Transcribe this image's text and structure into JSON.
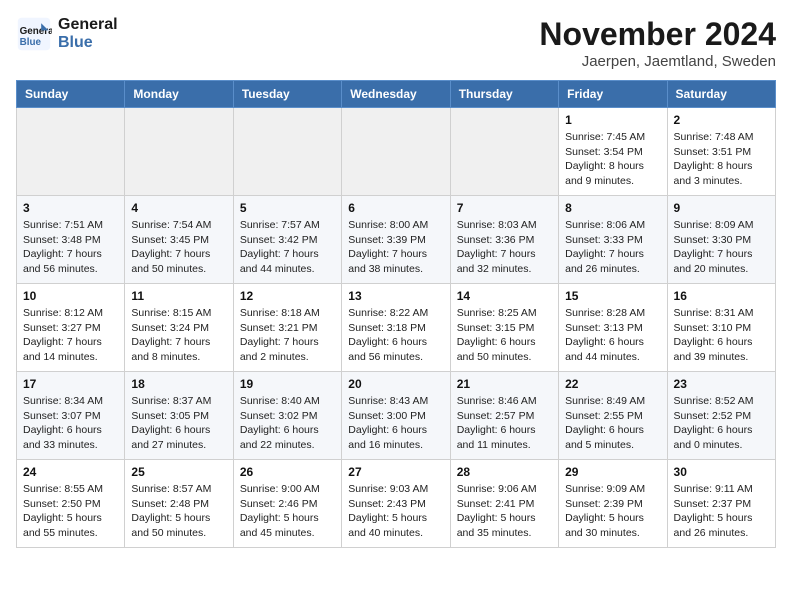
{
  "header": {
    "logo_line1": "General",
    "logo_line2": "Blue",
    "month_title": "November 2024",
    "location": "Jaerpen, Jaemtland, Sweden"
  },
  "weekdays": [
    "Sunday",
    "Monday",
    "Tuesday",
    "Wednesday",
    "Thursday",
    "Friday",
    "Saturday"
  ],
  "weeks": [
    [
      {
        "day": "",
        "info": ""
      },
      {
        "day": "",
        "info": ""
      },
      {
        "day": "",
        "info": ""
      },
      {
        "day": "",
        "info": ""
      },
      {
        "day": "",
        "info": ""
      },
      {
        "day": "1",
        "info": "Sunrise: 7:45 AM\nSunset: 3:54 PM\nDaylight: 8 hours\nand 9 minutes."
      },
      {
        "day": "2",
        "info": "Sunrise: 7:48 AM\nSunset: 3:51 PM\nDaylight: 8 hours\nand 3 minutes."
      }
    ],
    [
      {
        "day": "3",
        "info": "Sunrise: 7:51 AM\nSunset: 3:48 PM\nDaylight: 7 hours\nand 56 minutes."
      },
      {
        "day": "4",
        "info": "Sunrise: 7:54 AM\nSunset: 3:45 PM\nDaylight: 7 hours\nand 50 minutes."
      },
      {
        "day": "5",
        "info": "Sunrise: 7:57 AM\nSunset: 3:42 PM\nDaylight: 7 hours\nand 44 minutes."
      },
      {
        "day": "6",
        "info": "Sunrise: 8:00 AM\nSunset: 3:39 PM\nDaylight: 7 hours\nand 38 minutes."
      },
      {
        "day": "7",
        "info": "Sunrise: 8:03 AM\nSunset: 3:36 PM\nDaylight: 7 hours\nand 32 minutes."
      },
      {
        "day": "8",
        "info": "Sunrise: 8:06 AM\nSunset: 3:33 PM\nDaylight: 7 hours\nand 26 minutes."
      },
      {
        "day": "9",
        "info": "Sunrise: 8:09 AM\nSunset: 3:30 PM\nDaylight: 7 hours\nand 20 minutes."
      }
    ],
    [
      {
        "day": "10",
        "info": "Sunrise: 8:12 AM\nSunset: 3:27 PM\nDaylight: 7 hours\nand 14 minutes."
      },
      {
        "day": "11",
        "info": "Sunrise: 8:15 AM\nSunset: 3:24 PM\nDaylight: 7 hours\nand 8 minutes."
      },
      {
        "day": "12",
        "info": "Sunrise: 8:18 AM\nSunset: 3:21 PM\nDaylight: 7 hours\nand 2 minutes."
      },
      {
        "day": "13",
        "info": "Sunrise: 8:22 AM\nSunset: 3:18 PM\nDaylight: 6 hours\nand 56 minutes."
      },
      {
        "day": "14",
        "info": "Sunrise: 8:25 AM\nSunset: 3:15 PM\nDaylight: 6 hours\nand 50 minutes."
      },
      {
        "day": "15",
        "info": "Sunrise: 8:28 AM\nSunset: 3:13 PM\nDaylight: 6 hours\nand 44 minutes."
      },
      {
        "day": "16",
        "info": "Sunrise: 8:31 AM\nSunset: 3:10 PM\nDaylight: 6 hours\nand 39 minutes."
      }
    ],
    [
      {
        "day": "17",
        "info": "Sunrise: 8:34 AM\nSunset: 3:07 PM\nDaylight: 6 hours\nand 33 minutes."
      },
      {
        "day": "18",
        "info": "Sunrise: 8:37 AM\nSunset: 3:05 PM\nDaylight: 6 hours\nand 27 minutes."
      },
      {
        "day": "19",
        "info": "Sunrise: 8:40 AM\nSunset: 3:02 PM\nDaylight: 6 hours\nand 22 minutes."
      },
      {
        "day": "20",
        "info": "Sunrise: 8:43 AM\nSunset: 3:00 PM\nDaylight: 6 hours\nand 16 minutes."
      },
      {
        "day": "21",
        "info": "Sunrise: 8:46 AM\nSunset: 2:57 PM\nDaylight: 6 hours\nand 11 minutes."
      },
      {
        "day": "22",
        "info": "Sunrise: 8:49 AM\nSunset: 2:55 PM\nDaylight: 6 hours\nand 5 minutes."
      },
      {
        "day": "23",
        "info": "Sunrise: 8:52 AM\nSunset: 2:52 PM\nDaylight: 6 hours\nand 0 minutes."
      }
    ],
    [
      {
        "day": "24",
        "info": "Sunrise: 8:55 AM\nSunset: 2:50 PM\nDaylight: 5 hours\nand 55 minutes."
      },
      {
        "day": "25",
        "info": "Sunrise: 8:57 AM\nSunset: 2:48 PM\nDaylight: 5 hours\nand 50 minutes."
      },
      {
        "day": "26",
        "info": "Sunrise: 9:00 AM\nSunset: 2:46 PM\nDaylight: 5 hours\nand 45 minutes."
      },
      {
        "day": "27",
        "info": "Sunrise: 9:03 AM\nSunset: 2:43 PM\nDaylight: 5 hours\nand 40 minutes."
      },
      {
        "day": "28",
        "info": "Sunrise: 9:06 AM\nSunset: 2:41 PM\nDaylight: 5 hours\nand 35 minutes."
      },
      {
        "day": "29",
        "info": "Sunrise: 9:09 AM\nSunset: 2:39 PM\nDaylight: 5 hours\nand 30 minutes."
      },
      {
        "day": "30",
        "info": "Sunrise: 9:11 AM\nSunset: 2:37 PM\nDaylight: 5 hours\nand 26 minutes."
      }
    ]
  ]
}
